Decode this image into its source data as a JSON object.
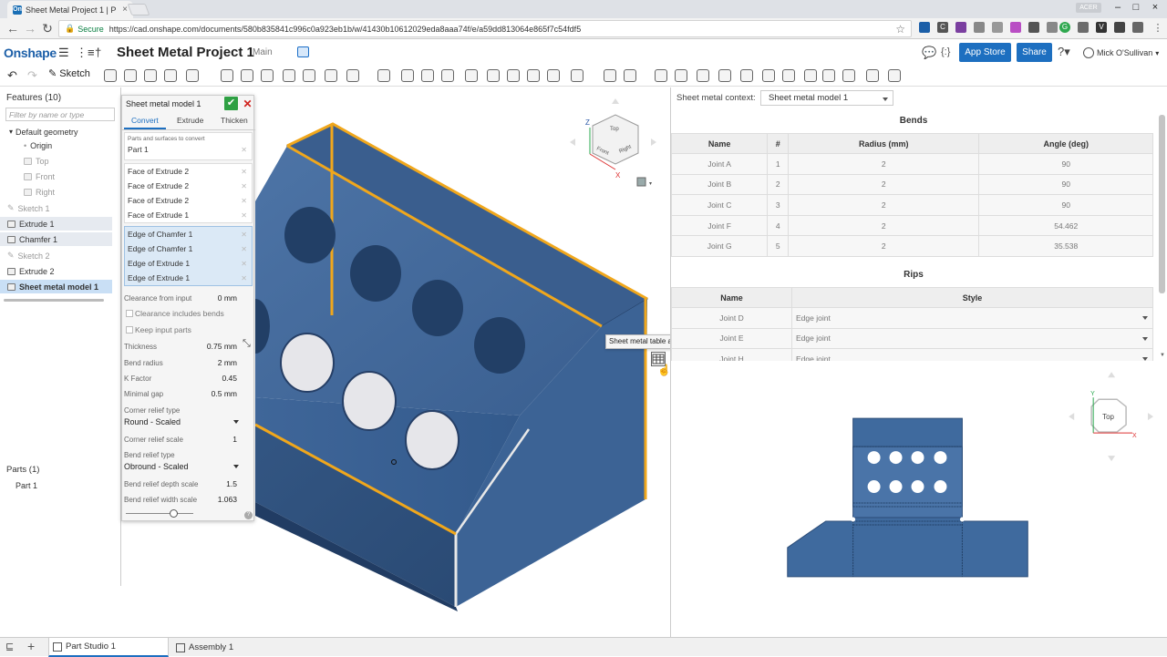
{
  "browser": {
    "tab_title": "Sheet Metal Project 1 | P",
    "favicon_text": "On",
    "secure_label": "Secure",
    "url": "https://cad.onshape.com/documents/580b835841c996c0a923eb1b/w/41430b10612029eda8aaa74f/e/a59dd813064e865f7c54fdf5",
    "badge": "ACER"
  },
  "header": {
    "logo": "Onshape",
    "document_title": "Sheet Metal Project 1",
    "branch": "Main",
    "app_store_label": "App Store",
    "share_label": "Share",
    "user_name": "Mick O'Sullivan",
    "brace_label": "{:}"
  },
  "toolbar": {
    "sketch_label": "Sketch"
  },
  "features": {
    "title": "Features (10)",
    "filter_placeholder": "Filter by name or type",
    "items": [
      {
        "label": "Default geometry",
        "state": "normal",
        "kind": "group"
      },
      {
        "label": "Origin",
        "state": "normal",
        "kind": "origin"
      },
      {
        "label": "Top",
        "state": "dim",
        "kind": "plane"
      },
      {
        "label": "Front",
        "state": "dim",
        "kind": "plane"
      },
      {
        "label": "Right",
        "state": "dim",
        "kind": "plane"
      },
      {
        "label": "Sketch 1",
        "state": "dim",
        "kind": "sketch"
      },
      {
        "label": "Extrude 1",
        "state": "hl",
        "kind": "feature"
      },
      {
        "label": "Chamfer 1",
        "state": "hl",
        "kind": "feature"
      },
      {
        "label": "Sketch 2",
        "state": "dim",
        "kind": "sketch"
      },
      {
        "label": "Extrude 2",
        "state": "normal",
        "kind": "feature"
      },
      {
        "label": "Sheet metal model 1",
        "state": "sel",
        "kind": "feature"
      }
    ],
    "parts_title": "Parts (1)",
    "parts": [
      "Part 1"
    ]
  },
  "dialog": {
    "title": "Sheet metal model 1",
    "tabs": [
      "Convert",
      "Extrude",
      "Thicken"
    ],
    "active_tab": "Convert",
    "parts_label": "Parts and surfaces to convert",
    "parts": [
      "Part 1"
    ],
    "faces": [
      "Face of Extrude 2",
      "Face of Extrude 2",
      "Face of Extrude 2",
      "Face of Extrude 1"
    ],
    "edges": [
      "Edge of Chamfer 1",
      "Edge of Chamfer 1",
      "Edge of Extrude 1",
      "Edge of Extrude 1"
    ],
    "clearance_label": "Clearance from input",
    "clearance_value": "0 mm",
    "clearance_bends_label": "Clearance includes bends",
    "keep_input_label": "Keep input parts",
    "thickness_label": "Thickness",
    "thickness_value": "0.75 mm",
    "bend_radius_label": "Bend radius",
    "bend_radius_value": "2 mm",
    "k_factor_label": "K Factor",
    "k_factor_value": "0.45",
    "minimal_gap_label": "Minimal gap",
    "minimal_gap_value": "0.5 mm",
    "corner_relief_type_label": "Corner relief type",
    "corner_relief_type_value": "Round - Scaled",
    "corner_relief_scale_label": "Corner relief scale",
    "corner_relief_scale_value": "1",
    "bend_relief_type_label": "Bend relief type",
    "bend_relief_type_value": "Obround - Scaled",
    "bend_relief_depth_label": "Bend relief depth scale",
    "bend_relief_depth_value": "1.5",
    "bend_relief_width_label": "Bend relief width scale",
    "bend_relief_width_value": "1.063"
  },
  "viewcube": {
    "top": "Top",
    "front": "Front",
    "right": "Right",
    "z": "Z",
    "x": "X"
  },
  "tooltip": "Sheet metal table and flat view",
  "sheet_metal": {
    "context_label": "Sheet metal context:",
    "context_value": "Sheet metal model 1",
    "bends_title": "Bends",
    "bends_headers": [
      "Name",
      "#",
      "Radius (mm)",
      "Angle (deg)"
    ],
    "bends": [
      [
        "Joint A",
        "1",
        "2",
        "90"
      ],
      [
        "Joint B",
        "2",
        "2",
        "90"
      ],
      [
        "Joint C",
        "3",
        "2",
        "90"
      ],
      [
        "Joint F",
        "4",
        "2",
        "54.462"
      ],
      [
        "Joint G",
        "5",
        "2",
        "35.538"
      ]
    ],
    "rips_title": "Rips",
    "rips_headers": [
      "Name",
      "Style"
    ],
    "rips": [
      [
        "Joint D",
        "Edge joint"
      ],
      [
        "Joint E",
        "Edge joint"
      ],
      [
        "Joint H",
        "Edge joint"
      ]
    ]
  },
  "flat_view": {
    "view_label": "Top",
    "y": "Y",
    "x": "X"
  },
  "bottom_tabs": [
    "Part Studio 1",
    "Assembly 1"
  ],
  "colors": {
    "part_blue": "#3e6496",
    "edge_highlight": "#f0a71c",
    "accent": "#1d6fc0"
  }
}
